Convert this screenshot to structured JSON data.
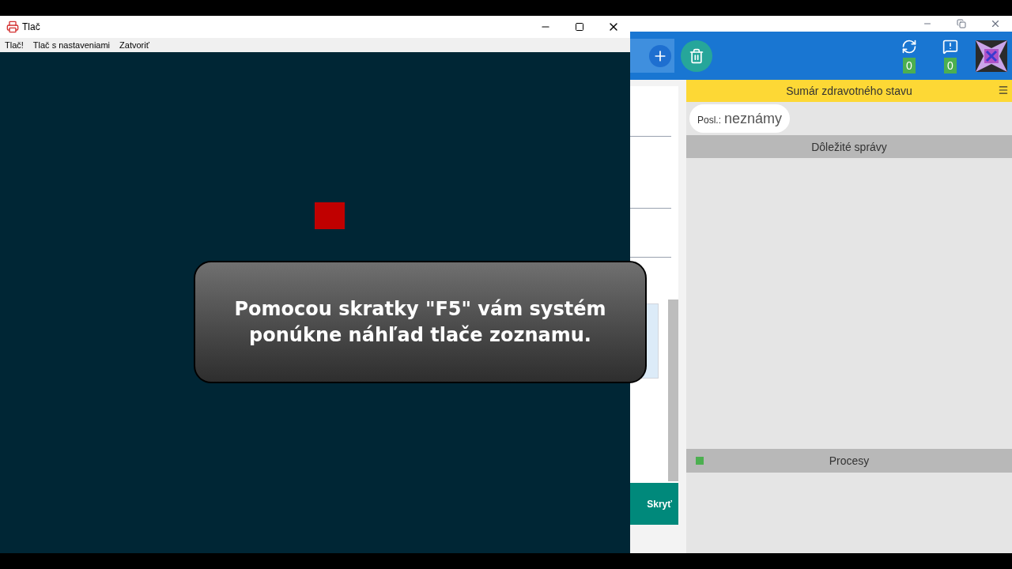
{
  "print_window": {
    "title": "Tlač",
    "menu": [
      "Tlač!",
      "Tlač s nastaveniami",
      "Zatvoriť"
    ]
  },
  "app": {
    "counters": [
      {
        "kind": "sync",
        "value": "0"
      },
      {
        "kind": "alert",
        "value": "0"
      }
    ],
    "health_summary": {
      "title": "Sumár zdravotného stavu",
      "last_label": "Posl.:",
      "last_value": "neznámy"
    },
    "important_messages": {
      "title": "Dôležité správy"
    },
    "processes": {
      "title": "Procesy",
      "color": "#4caf50"
    },
    "hide_button": "Skryť"
  },
  "caption": "Pomocou skratky \"F5\" vám systém ponúkne náhľad tlače zoznamu."
}
